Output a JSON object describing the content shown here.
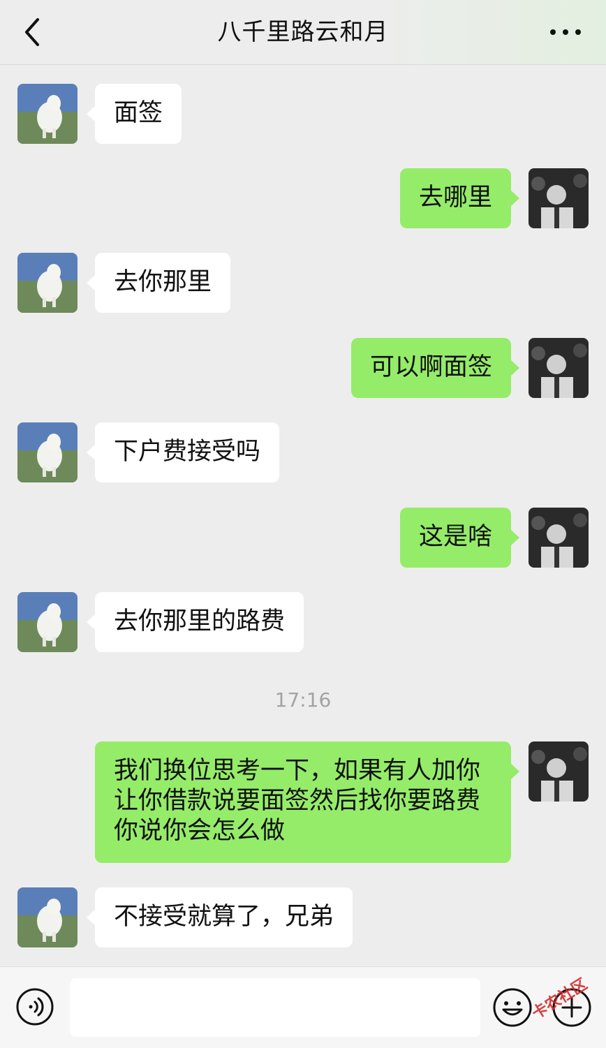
{
  "header": {
    "title": "八千里路云和月"
  },
  "messages": [
    {
      "side": "in",
      "text": "面签"
    },
    {
      "side": "out",
      "text": "去哪里"
    },
    {
      "side": "in",
      "text": "去你那里"
    },
    {
      "side": "out",
      "text": "可以啊面签"
    },
    {
      "side": "in",
      "text": "下户费接受吗"
    },
    {
      "side": "out",
      "text": "这是啥"
    },
    {
      "side": "in",
      "text": "去你那里的路费"
    },
    {
      "side": "out",
      "text": "我们换位思考一下，如果有人加你\n让你借款说要面签然后找你要路费\n你说你会怎么做"
    },
    {
      "side": "in",
      "text": "不接受就算了，兄弟"
    }
  ],
  "timestamp": "17:16",
  "input_bar": {
    "placeholder": "",
    "icons": [
      "voice-icon",
      "emoji-icon",
      "plus-icon"
    ]
  },
  "watermark": "卡农社区",
  "colors": {
    "incoming_bubble": "#ffffff",
    "outgoing_bubble": "#95ec69",
    "background": "#ededed"
  }
}
